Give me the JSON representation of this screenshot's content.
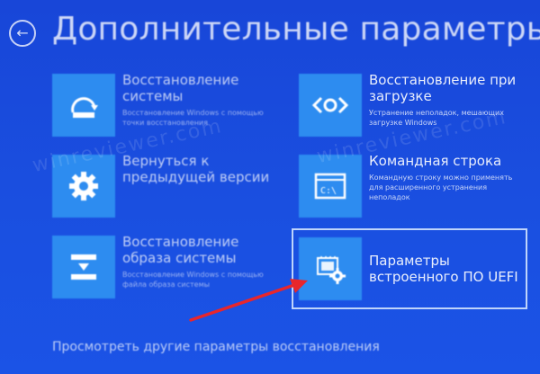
{
  "header": {
    "back_glyph": "←",
    "title": "Дополнительные параметры"
  },
  "tiles": [
    {
      "title": "Восстановление системы",
      "desc": "Восстановление Windows с помощью точки восстановления",
      "icon": "system-restore-icon"
    },
    {
      "title": "Восстановление при загрузке",
      "desc": "Устранение неполадок, мешающих загрузке Windows",
      "icon": "startup-repair-icon"
    },
    {
      "title": "Вернуться к предыдущей версии",
      "desc": "",
      "icon": "gear-icon"
    },
    {
      "title": "Командная строка",
      "desc": "Командную строку можно применять для расширенного устранения неполадок",
      "icon": "command-prompt-icon"
    },
    {
      "title": "Восстановление образа системы",
      "desc": "Восстановление Windows с помощью файла образа системы",
      "icon": "image-recovery-icon"
    },
    {
      "title": "Параметры встроенного ПО UEFI",
      "desc": "",
      "icon": "uefi-settings-icon"
    }
  ],
  "footer": {
    "link": "Просмотреть другие параметры восстановления"
  },
  "watermark": "winreviewer.com",
  "colors": {
    "background": "#1a4ae0",
    "tile_icon": "#2d8cf0",
    "arrow": "#e8262c"
  }
}
